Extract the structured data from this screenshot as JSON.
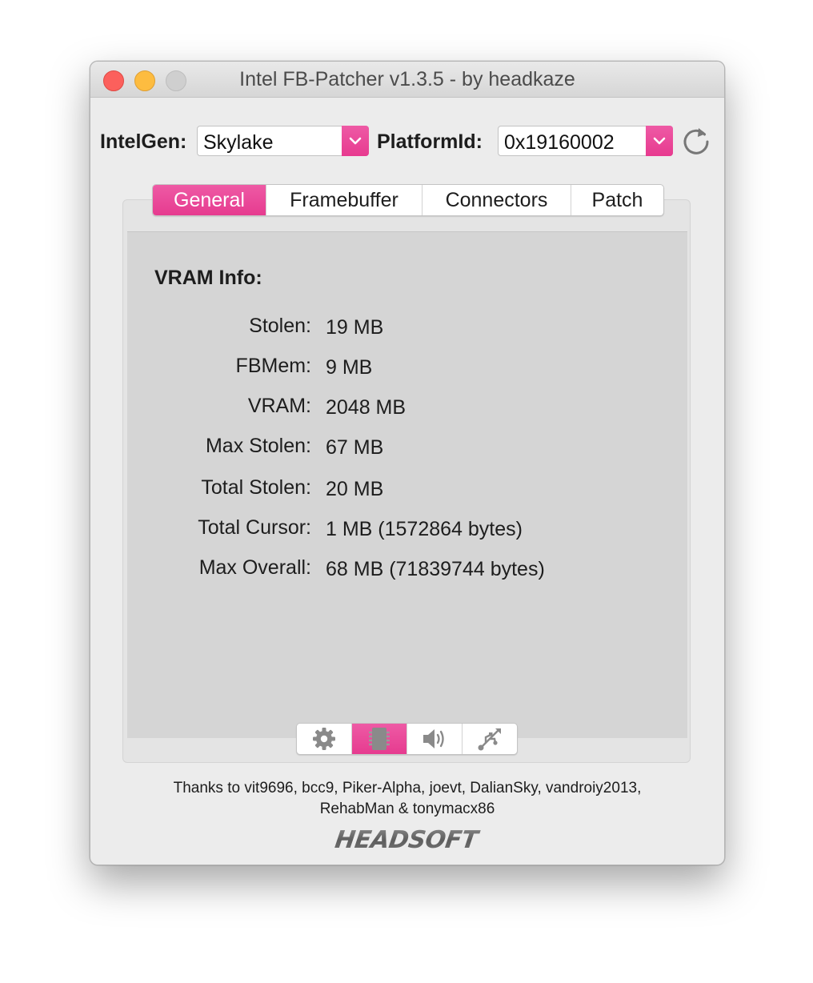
{
  "window": {
    "title": "Intel FB-Patcher v1.3.5 - by headkaze"
  },
  "toolbar": {
    "intelgen_label": "IntelGen:",
    "intelgen_value": "Skylake",
    "platformid_label": "PlatformId:",
    "platformid_value": "0x19160002",
    "refresh_icon": "refresh-icon"
  },
  "tabs": [
    {
      "label": "General",
      "active": true
    },
    {
      "label": "Framebuffer",
      "active": false
    },
    {
      "label": "Connectors",
      "active": false
    },
    {
      "label": "Patch",
      "active": false
    }
  ],
  "vram": {
    "title": "VRAM Info:",
    "rows": [
      {
        "label": "Stolen:",
        "value": "19 MB"
      },
      {
        "label": "FBMem:",
        "value": "9 MB"
      },
      {
        "label": "VRAM:",
        "value": "2048 MB"
      },
      {
        "label": "Max Stolen:",
        "value": "67 MB"
      },
      {
        "label": "Total Stolen:",
        "value": "20 MB"
      },
      {
        "label": "Total Cursor:",
        "value": "1 MB (1572864 bytes)"
      },
      {
        "label": "Max Overall:",
        "value": "68 MB (71839744 bytes)"
      }
    ]
  },
  "bottom_tabs": [
    {
      "icon": "gear-icon",
      "active": false
    },
    {
      "icon": "chip-icon",
      "active": true
    },
    {
      "icon": "speaker-icon",
      "active": false
    },
    {
      "icon": "usb-icon",
      "active": false
    }
  ],
  "footer": {
    "credits_line1": "Thanks to vit9696, bcc9, Piker-Alpha, joevt, DalianSky, vandroiy2013,",
    "credits_line2": "RehabMan & tonymacx86",
    "logo_text": "HEADSOFT"
  },
  "colors": {
    "accent": "#e8428f",
    "window_bg": "#ececec",
    "panel_bg": "#d5d5d5"
  }
}
